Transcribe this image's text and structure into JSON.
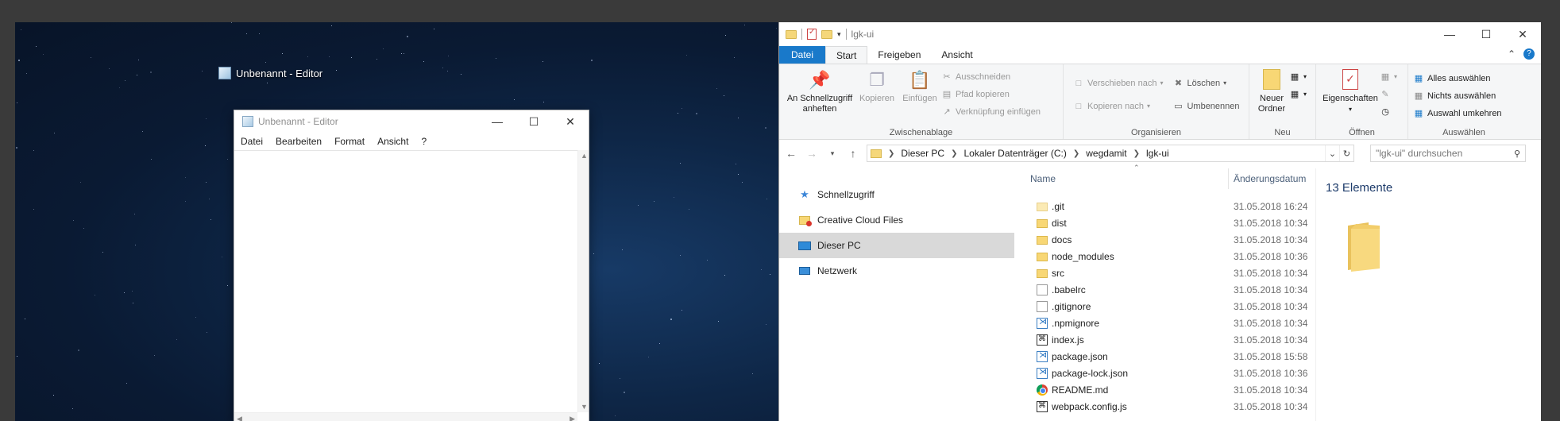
{
  "desktop": {
    "taskbar_label": "Unbenannt - Editor"
  },
  "notepad": {
    "title": "Unbenannt - Editor",
    "menu": [
      "Datei",
      "Bearbeiten",
      "Format",
      "Ansicht",
      "?"
    ],
    "content": ""
  },
  "explorer": {
    "title": "lgk-ui",
    "tabs": [
      "Datei",
      "Start",
      "Freigeben",
      "Ansicht"
    ],
    "active_tab": "Start",
    "ribbon": {
      "clipboard": {
        "label": "Zwischenablage",
        "pin": "An Schnellzugriff anheften",
        "copy": "Kopieren",
        "paste": "Einfügen",
        "cut": "Ausschneiden",
        "copy_path": "Pfad kopieren",
        "paste_shortcut": "Verknüpfung einfügen"
      },
      "organize": {
        "label": "Organisieren",
        "move_to": "Verschieben nach",
        "copy_to": "Kopieren nach",
        "delete": "Löschen",
        "rename": "Umbenennen"
      },
      "new": {
        "label": "Neu",
        "new_folder": "Neuer Ordner"
      },
      "open": {
        "label": "Öffnen",
        "properties": "Eigenschaften"
      },
      "select": {
        "label": "Auswählen",
        "select_all": "Alles auswählen",
        "select_none": "Nichts auswählen",
        "invert": "Auswahl umkehren"
      }
    },
    "address": {
      "crumbs": [
        "Dieser PC",
        "Lokaler Datenträger (C:)",
        "wegdamit",
        "lgk-ui"
      ],
      "search_placeholder": "\"lgk-ui\" durchsuchen"
    },
    "nav": [
      {
        "label": "Schnellzugriff",
        "icon": "star-icon"
      },
      {
        "label": "Creative Cloud Files",
        "icon": "creative-cloud-icon"
      },
      {
        "label": "Dieser PC",
        "icon": "computer-icon",
        "selected": true
      },
      {
        "label": "Netzwerk",
        "icon": "network-icon"
      }
    ],
    "columns": {
      "name": "Name",
      "date": "Änderungsdatum"
    },
    "files": [
      {
        "name": ".git",
        "date": "31.05.2018 16:24",
        "type": "folder-light"
      },
      {
        "name": "dist",
        "date": "31.05.2018 10:34",
        "type": "folder"
      },
      {
        "name": "docs",
        "date": "31.05.2018 10:34",
        "type": "folder"
      },
      {
        "name": "node_modules",
        "date": "31.05.2018 10:36",
        "type": "folder"
      },
      {
        "name": "src",
        "date": "31.05.2018 10:34",
        "type": "folder"
      },
      {
        "name": ".babelrc",
        "date": "31.05.2018 10:34",
        "type": "file"
      },
      {
        "name": ".gitignore",
        "date": "31.05.2018 10:34",
        "type": "file"
      },
      {
        "name": ".npmignore",
        "date": "31.05.2018 10:34",
        "type": "code"
      },
      {
        "name": "index.js",
        "date": "31.05.2018 10:34",
        "type": "js"
      },
      {
        "name": "package.json",
        "date": "31.05.2018 15:58",
        "type": "code"
      },
      {
        "name": "package-lock.json",
        "date": "31.05.2018 10:36",
        "type": "code"
      },
      {
        "name": "README.md",
        "date": "31.05.2018 10:34",
        "type": "chrome"
      },
      {
        "name": "webpack.config.js",
        "date": "31.05.2018 10:34",
        "type": "js"
      }
    ],
    "item_count": "13 Elemente"
  }
}
